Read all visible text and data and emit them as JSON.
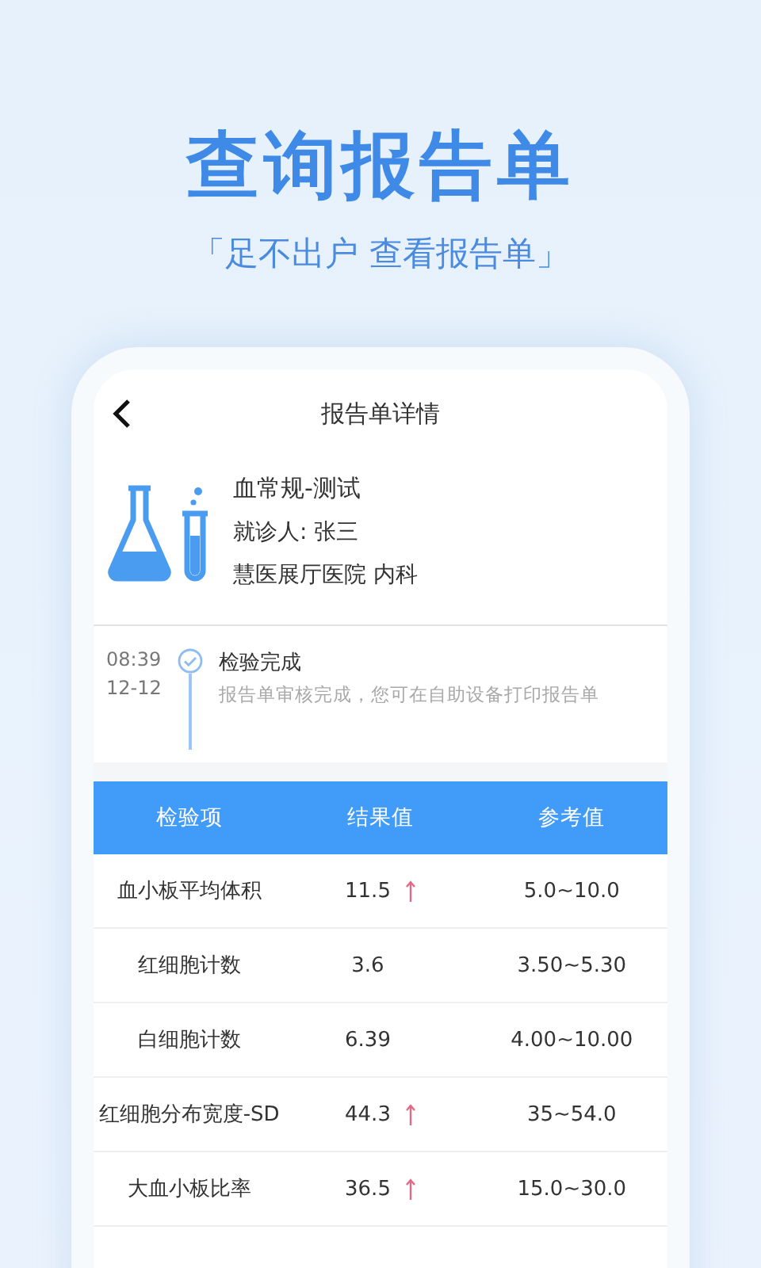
{
  "headline": "查询报告单",
  "tagline": "「足不出户 查看报告单」",
  "screen": {
    "title": "报告单详情",
    "report": {
      "name": "血常规-测试",
      "patient": "就诊人: 张三",
      "hospital": "慧医展厅医院 内科"
    },
    "timeline": [
      {
        "time": "08:39",
        "date": "12-12",
        "status": "检验完成",
        "detail": "报告单审核完成，您可在自助设备打印报告单",
        "done": true
      }
    ],
    "table": {
      "columns": [
        "检验项",
        "结果值",
        "参考值"
      ],
      "rows": [
        {
          "item": "血小板平均体积",
          "result": "11.5",
          "high": true,
          "reference": "5.0~10.0"
        },
        {
          "item": "红细胞计数",
          "result": "3.6",
          "high": false,
          "reference": "3.50~5.30"
        },
        {
          "item": "白细胞计数",
          "result": "6.39",
          "high": false,
          "reference": "4.00~10.00"
        },
        {
          "item": "红细胞分布宽度-SD",
          "result": "44.3",
          "high": true,
          "reference": "35~54.0"
        },
        {
          "item": "大血小板比率",
          "result": "36.5",
          "high": true,
          "reference": "15.0~30.0"
        }
      ]
    }
  }
}
